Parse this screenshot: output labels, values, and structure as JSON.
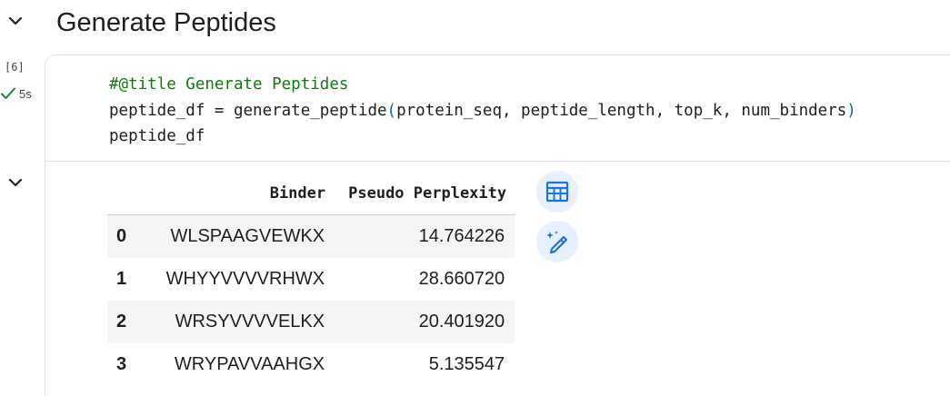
{
  "section": {
    "title": "Generate Peptides",
    "collapse_icon": "chevron-down-icon"
  },
  "cell": {
    "execution_count": "[6]",
    "status_icon": "check-icon",
    "status_time": "5s",
    "code": {
      "line1": "#@title Generate Peptides",
      "line2_before": "peptide_df = generate_peptide",
      "line2_open": "(",
      "line2_args": "protein_seq, peptide_length, top_k, num_binders",
      "line2_close": ")",
      "line3": "peptide_df"
    }
  },
  "output": {
    "collapse_icon": "chevron-down-icon",
    "table": {
      "columns": [
        "",
        "Binder",
        "Pseudo Perplexity"
      ],
      "rows": [
        {
          "index": "0",
          "binder": "WLSPAAGVEWKX",
          "perplexity": "14.764226"
        },
        {
          "index": "1",
          "binder": "WHYYVVVVRHWX",
          "perplexity": "28.660720"
        },
        {
          "index": "2",
          "binder": "WRSYVVVVELKX",
          "perplexity": "20.401920"
        },
        {
          "index": "3",
          "binder": "WRYPAVVAAHGX",
          "perplexity": "5.135547"
        }
      ]
    },
    "actions": [
      {
        "icon": "table-icon"
      },
      {
        "icon": "magic-pen-icon"
      }
    ]
  },
  "colors": {
    "accent": "#1a73e8",
    "success": "#188038",
    "comment": "#107a10",
    "button_bg": "#e8f0fe"
  }
}
